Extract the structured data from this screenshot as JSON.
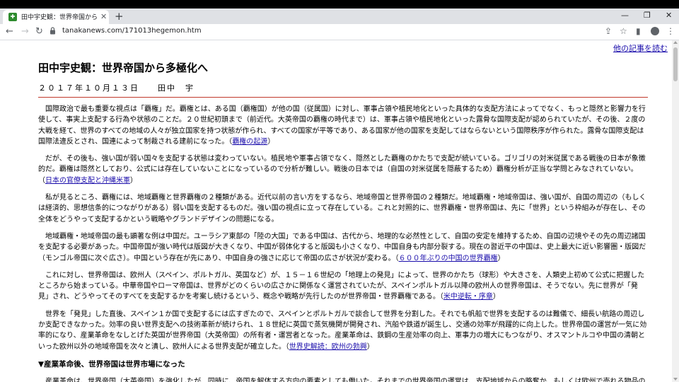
{
  "browser": {
    "tab_title": "田中宇史観：世界帝国から多極化へ",
    "tab_close": "✕",
    "new_tab": "+",
    "url": "tanakanews.com/171013hegemon.htm",
    "window_minimize": "—",
    "window_maximize": "❐",
    "window_close": "✕"
  },
  "page": {
    "other_articles_link": "他の記事を読む",
    "title": "田中宇史観：世界帝国から多極化へ",
    "byline": "２０１７年１０月１３日　　田中　宇",
    "paragraphs": [
      {
        "text": "国際政治で最も重要な視点は「覇権」だ。覇権とは、ある国（覇権国）が他の国（従属国）に対し、軍事占領や植民地化といった具体的な支配方法によってでなく、もっと隠然と影響力を行使して、事実上支配する行為や状態のことだ。２０世紀初頭まで（前近代。大英帝国の覇権の時代まで）は、軍事占領や植民地化といった露骨な国際支配が認められていたが、その後、２度の大戦を経て、世界のすべての地域の人々が独立国家を持つ状態が作られ、すべての国家が平等であり、ある国家が他の国家を支配してはならないという国際秩序が作られた。露骨な国際支配は国際法違反とされ、国連によって制裁される建前になった。（",
        "link": "覇権の起源",
        "tail": "）"
      },
      {
        "text": "だが、その後も、強い国が弱い国々を支配する状態は変わっていない。植民地や軍事占領でなく、隠然とした覇権のかたちで支配が続いている。ゴリゴリの対米従属である戦後の日本が象徴的だ。覇権は隠然としており、公式には存在していないことになっているので分析が難しい。戦後の日本では（自国の対米従属を隠蔽するため）覇権分析が正当な学問とみなされていない。（",
        "link": "日本の官僚支配と沖縄米軍",
        "tail": "）"
      },
      {
        "text": "私が見るところ、覇権には、地域覇権と世界覇権の２種類がある。近代以前の言い方をするなら、地域帝国と世界帝国の２種類だ。地域覇権・地域帝国は、強い国が、自国の周辺の（もしくは経済的、思想信条的につながりがある）弱い国を支配するものだ。強い国の視点に立って存在している。これと対照的に、世界覇権・世界帝国は、先に「世界」という枠組みが存在し、その全体をどうやって支配するかという戦略やグランドデザインの問題になる。",
        "link": "",
        "tail": ""
      },
      {
        "text": "地域覇権・地域帝国の最も顕著な例は中国だ。ユーラシア東部の「陸の大国」である中国は、古代から、地理的な必然性として、自国の安定を維持するため、自国の辺境やその先の周辺諸国を支配する必要があった。中国帝国が強い時代は版図が大きくなり、中国が弱体化すると版図も小さくなり、中国自身も内部分裂する。現在の習近平の中国は、史上最大に近い影響圏・版図だ（モンゴル帝国に次ぐ広さ）。中国という存在が先にあり、中国自身の強さに応じて帝国の広さが状況が変わる。（",
        "link": "６００年ぶりの中国の世界覇権",
        "tail": "）"
      },
      {
        "text": "これに対し、世界帝国は、欧州人（スペイン、ポルトガル、英国など）が、１５－１６世紀の「地理上の発見」によって、世界のかたち（球形）や大きさを、人類史上初めて公式に把握したところから始まっている。中華帝国やローマ帝国は、世界がどのくらいの広さかに関係なく運営されていたが、スペインポルトガル以降の欧州人の世界帝国は、そうでない。先に世界が「発見」され、どうやってそのすべてを支配するかを考案し続けるという、概念や戦略が先行したのが世界帝国・世界覇権である。（",
        "link": "米中逆転・序章",
        "tail": "）"
      },
      {
        "text": "世界を「発見」した直後、スペイン１か国で支配するには広すぎたので、スペインとポルトガルで談合して世界を分割した。それでも帆船で世界を支配するのは難儀で、細長い航路の周辺しか支配できなかった。効率の良い世界支配への技術革新が続けられ、１８世紀に英国で蒸気機関が開発され、汽船や鉄道が誕生し、交通の効率が飛躍的に向上した。世界帝国の運営が一気に効率的になり、産業革命をなしとげた英国が世界帝国（大英帝国）の所有者・運営者となった。産業革命は、鉄鋼の生産効率の向上、軍事力の増大にもつながり、オスマントルコや中国の清朝といった欧州以外の地域帝国を次々と潰し、欧州人による世界支配が確立した。（",
        "link": "世界史解読：欧州の勃興",
        "tail": "）"
      }
    ],
    "section_heading": "▼産業革命後、世界帝国は世界市場になった",
    "last_paragraph": "産業革命は、世界帝国（大英帝国）を強化したが、同時に、帝国を解体する方向の要素としても働いた。それまでの世界帝国の運営は、支配地域からの略奪か、もしくは欧州で売れる物品の採掘や栽培を植民地に強要するやり方だったが、産業革命によって欧州の工業製品の生産力が急拡大すると、欧州が作った工業製品を買わせる市場として、植民地が重要になった。植民地の"
  }
}
